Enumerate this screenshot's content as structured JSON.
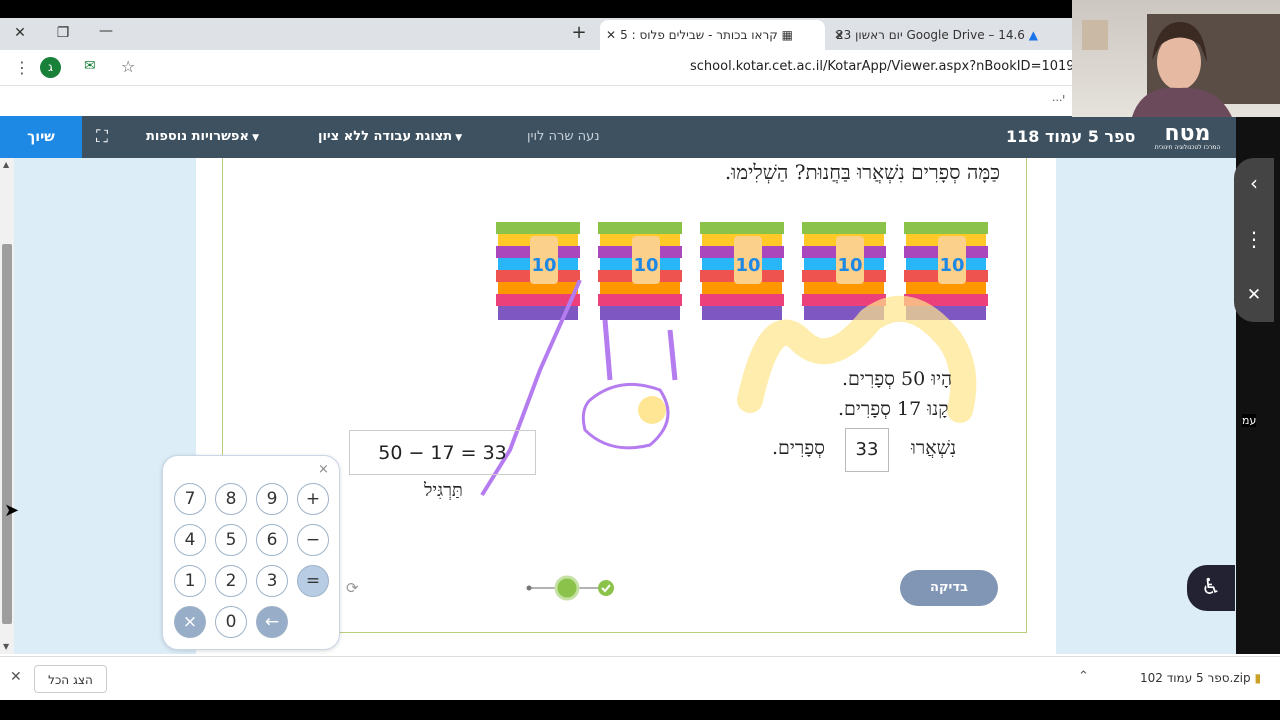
{
  "browser": {
    "tabs": [
      {
        "label": "קראו בכותר - שבילים פלוס : 5",
        "active": true
      },
      {
        "label": "Google Drive – 14.6 יום ראשון 23",
        "active": false
      }
    ],
    "new_tab": "+",
    "url": "school.kotar.cet.ac.il/KotarApp/Viewer.aspx?nBookID=101958379#",
    "profile_initial": "ג",
    "bookmark_overflow": "...י"
  },
  "appbar": {
    "logo": "מטח",
    "logo_sub": "המרכז לטכנולוגיה חינוכית",
    "book_title": "ספר 5 עמוד 118",
    "user": "נעה שרה לוין",
    "work_view": "תצוגת עבודה ללא ציון",
    "more_options": "אפשרויות נוספות",
    "share": "שיוך"
  },
  "exercise": {
    "question": "כַּמָּה סְפָרִים נִשְׁאֲרוּ בַּחֲנוּת? הַשְׁלִימוּ.",
    "book_tag": "10",
    "line1": "הָיוּ 50 סְפָרִים.",
    "line2": "קָנוּ 17 סְפָרִים.",
    "line3_prefix": "נִשְׁאֲרוּ",
    "answer": "33",
    "line3_suffix": "סְפָרִים.",
    "equation": "50 − 17 = 33",
    "practice_label": "תַּרְגִּיל",
    "check_button": "בדיקה"
  },
  "calculator": {
    "keys": [
      "7",
      "8",
      "9",
      "+",
      "4",
      "5",
      "6",
      "−",
      "1",
      "2",
      "3",
      "=",
      "×",
      "0",
      "←"
    ],
    "close": "×"
  },
  "downloads": {
    "show_all": "הצג הכל",
    "file": "ספר 5 עמוד 102.zip"
  },
  "side": {
    "label": "עמ"
  },
  "colors": {
    "appbar": "#3d5160",
    "share": "#1e88e5",
    "content_bg": "#dcedf8",
    "check_button": "#8196b4",
    "progress_green": "#8bc34a"
  }
}
